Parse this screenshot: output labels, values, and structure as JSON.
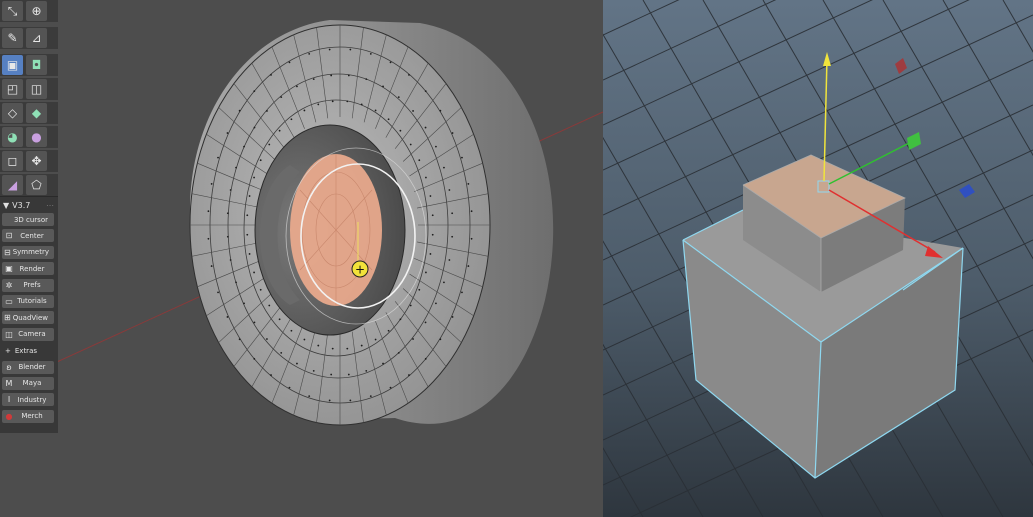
{
  "left_viewport": {
    "panel": {
      "version": "V3.7",
      "buttons": [
        {
          "label": "3D cursor",
          "icon": ""
        },
        {
          "label": "Center",
          "icon": "⊡"
        },
        {
          "label": "Symmetry",
          "icon": "⊟"
        },
        {
          "label": "Render",
          "icon": "▣"
        },
        {
          "label": "Prefs",
          "icon": "✲"
        },
        {
          "label": "Tutorials",
          "icon": "▭"
        },
        {
          "label": "QuadView",
          "icon": "⊞"
        },
        {
          "label": "Camera",
          "icon": "◫"
        }
      ],
      "extras_label": "Extras",
      "extras_icon": "+",
      "links": [
        {
          "label": "Blender",
          "icon": "ʚ"
        },
        {
          "label": "Maya",
          "icon": "M"
        },
        {
          "label": "Industry",
          "icon": "I"
        },
        {
          "label": "Merch",
          "icon": "●"
        }
      ]
    },
    "colors": {
      "face_highlight": "#e8a98c",
      "wire": "#3a3a3a",
      "background": "#4d4d4d"
    }
  },
  "right_viewport": {
    "colors": {
      "selection_outline": "#8fd8f0",
      "y_axis": "#f0e43c",
      "x_axis": "#e03030",
      "z_axis": "#30c030"
    }
  }
}
